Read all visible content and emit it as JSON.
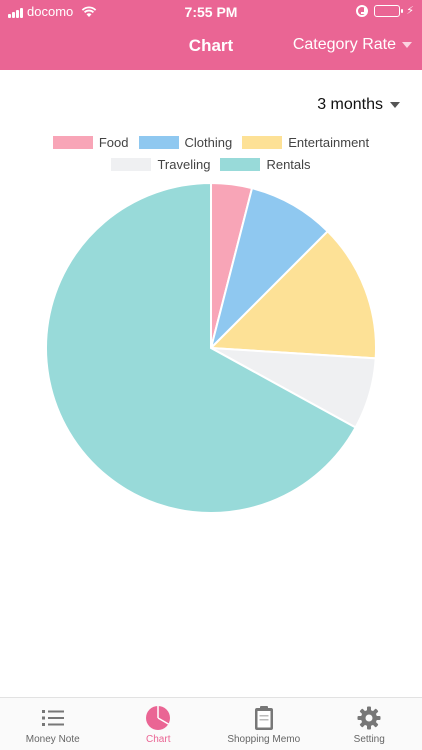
{
  "status_bar": {
    "carrier": "docomo",
    "time": "7:55 PM"
  },
  "nav": {
    "title": "Chart",
    "right_label": "Category Rate"
  },
  "period": {
    "selected": "3 months"
  },
  "colors": {
    "brand": "#ea6594"
  },
  "chart_data": {
    "type": "pie",
    "title": "",
    "legend": [
      {
        "label": "Food",
        "color": "#f8a5b7"
      },
      {
        "label": "Clothing",
        "color": "#8fc8f0"
      },
      {
        "label": "Entertainment",
        "color": "#fde196"
      },
      {
        "label": "Traveling",
        "color": "#eff0f2"
      },
      {
        "label": "Rentals",
        "color": "#98dad9"
      }
    ],
    "slices": [
      {
        "label": "Food",
        "value": 4
      },
      {
        "label": "Clothing",
        "value": 8.5
      },
      {
        "label": "Entertainment",
        "value": 13.5
      },
      {
        "label": "Traveling",
        "value": 7
      },
      {
        "label": "Rentals",
        "value": 67
      }
    ]
  },
  "tabbar": {
    "tabs": [
      {
        "label": "Money Note",
        "icon": "list-icon"
      },
      {
        "label": "Chart",
        "icon": "pie-chart-icon"
      },
      {
        "label": "Shopping Memo",
        "icon": "clipboard-icon"
      },
      {
        "label": "Setting",
        "icon": "gear-icon"
      }
    ],
    "active_tab": "Chart"
  }
}
